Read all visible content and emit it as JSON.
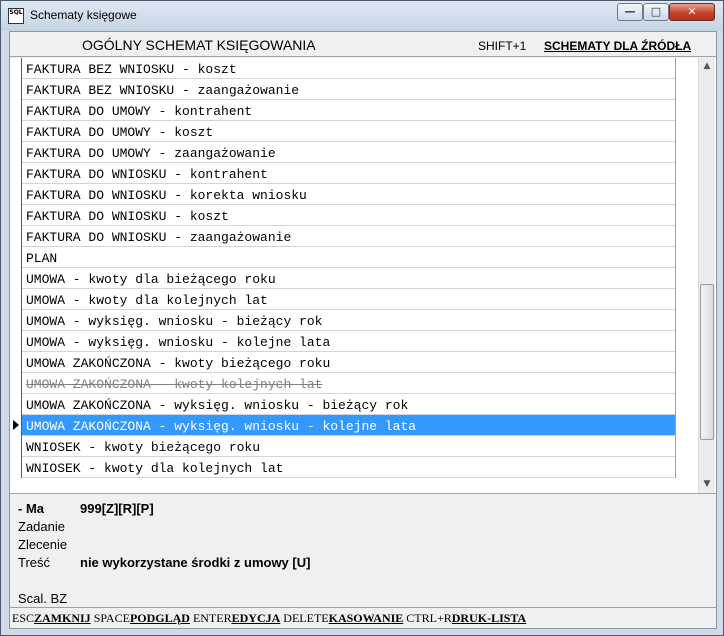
{
  "window": {
    "icon_text": "SQL",
    "title": "Schematy księgowe",
    "controls": {
      "minimize": "—",
      "maximize": "□",
      "close": "✕"
    }
  },
  "header": {
    "title": "OGÓLNY SCHEMAT KSIĘGOWANIA",
    "shortcut": "SHIFT+1",
    "link": "SCHEMATY DLA ŹRÓDŁA"
  },
  "rows": [
    {
      "text": "FAKTURA BEZ WNIOSKU - koszt"
    },
    {
      "text": "FAKTURA BEZ WNIOSKU - zaangażowanie"
    },
    {
      "text": "FAKTURA DO UMOWY - kontrahent"
    },
    {
      "text": "FAKTURA DO UMOWY - koszt"
    },
    {
      "text": "FAKTURA DO UMOWY - zaangażowanie"
    },
    {
      "text": "FAKTURA DO WNIOSKU - kontrahent"
    },
    {
      "text": "FAKTURA DO WNIOSKU - korekta wniosku"
    },
    {
      "text": "FAKTURA DO WNIOSKU - koszt"
    },
    {
      "text": "FAKTURA DO WNIOSKU - zaangażowanie"
    },
    {
      "text": "PLAN"
    },
    {
      "text": "UMOWA - kwoty dla bieżącego roku"
    },
    {
      "text": "UMOWA - kwoty dla kolejnych lat"
    },
    {
      "text": "UMOWA - wyksięg. wniosku - bieżący rok"
    },
    {
      "text": "UMOWA - wyksięg. wniosku - kolejne lata"
    },
    {
      "text": "UMOWA ZAKOŃCZONA - kwoty bieżącego roku"
    },
    {
      "text": "UMOWA ZAKOŃCZONA - kwoty kolejnych lat",
      "strikethrough": true
    },
    {
      "text": "UMOWA ZAKOŃCZONA - wyksięg. wniosku - bieżący rok"
    },
    {
      "text": "UMOWA ZAKOŃCZONA - wyksięg. wniosku - kolejne lata",
      "selected": true
    },
    {
      "text": "WNIOSEK - kwoty bieżącego roku"
    },
    {
      "text": "WNIOSEK - kwoty dla kolejnych lat"
    }
  ],
  "details": {
    "side_label": "- Ma",
    "side_value": "999[Z][R][P]",
    "zadanie_label": "Zadanie",
    "zlecenie_label": "Zlecenie",
    "tresc_label": "Treść",
    "tresc_value": "nie wykorzystane środki z umowy [U]",
    "scal_label": "Scal. BZ"
  },
  "statusbar": [
    {
      "key": "ESC",
      "action": "ZAMKNIJ"
    },
    {
      "key": "SPACE",
      "action": "PODGLĄD"
    },
    {
      "key": "ENTER",
      "action": "EDYCJA"
    },
    {
      "key": "DELETE",
      "action": "KASOWANIE"
    },
    {
      "key": "CTRL+R",
      "action": "DRUK-LISTA"
    }
  ],
  "colors": {
    "selection": "#3399ff",
    "window_frame": "#cfdbe8"
  }
}
